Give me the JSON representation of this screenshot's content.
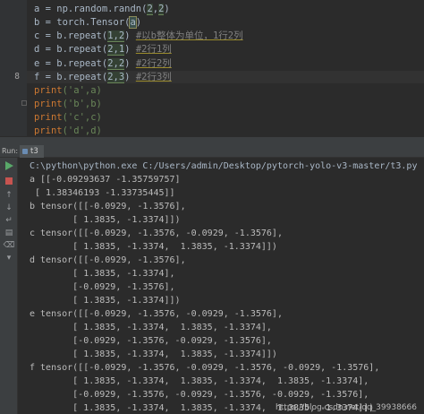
{
  "editor": {
    "line_numbers": [
      "",
      "",
      "",
      "",
      "",
      "8",
      "",
      "",
      "",
      ""
    ],
    "lines": [
      {
        "pre": "a = np.random.randn(",
        "mid": "2",
        "sep": ",",
        "mid2": "2",
        "post": ")"
      },
      {
        "pre": "b = torch.Tensor(",
        "sel": "a",
        "post": ")"
      },
      {
        "pre": "c = b.repeat(",
        "args": "1,2",
        "post": ") ",
        "comment": "#以b整体为单位，1行2列"
      },
      {
        "pre": "d = b.repeat(",
        "args": "2,1",
        "post": ") ",
        "comment": "#2行1列"
      },
      {
        "pre": "e = b.repeat(",
        "args": "2,2",
        "post": ") ",
        "comment": "#2行2列"
      },
      {
        "pre": "f = b.repeat(",
        "args": "2,3",
        "post": ") ",
        "comment": "#2行3列"
      },
      {
        "fn": "print",
        "open": "('",
        "arg": "a",
        "close": "',a)"
      },
      {
        "fn": "print",
        "open": "('",
        "arg": "b",
        "close": "',b)"
      },
      {
        "fn": "print",
        "open": "('",
        "arg": "c",
        "close": "',c)"
      },
      {
        "fn": "print",
        "open": "('",
        "arg": "d",
        "close": "',d)"
      }
    ]
  },
  "run": {
    "label": "Run:",
    "tab": "t3"
  },
  "console": {
    "command": "C:\\python\\python.exe C:/Users/admin/Desktop/pytorch-yolo-v3-master/t3.py",
    "output": [
      "a [[-0.09293637 -1.35759757]",
      " [ 1.38346193 -1.33735445]]",
      "b tensor([[-0.0929, -1.3576],",
      "        [ 1.3835, -1.3374]])",
      "c tensor([[-0.0929, -1.3576, -0.0929, -1.3576],",
      "        [ 1.3835, -1.3374,  1.3835, -1.3374]])",
      "d tensor([[-0.0929, -1.3576],",
      "        [ 1.3835, -1.3374],",
      "        [-0.0929, -1.3576],",
      "        [ 1.3835, -1.3374]])",
      "e tensor([[-0.0929, -1.3576, -0.0929, -1.3576],",
      "        [ 1.3835, -1.3374,  1.3835, -1.3374],",
      "        [-0.0929, -1.3576, -0.0929, -1.3576],",
      "        [ 1.3835, -1.3374,  1.3835, -1.3374]])",
      "f tensor([[-0.0929, -1.3576, -0.0929, -1.3576, -0.0929, -1.3576],",
      "        [ 1.3835, -1.3374,  1.3835, -1.3374,  1.3835, -1.3374],",
      "        [-0.0929, -1.3576, -0.0929, -1.3576, -0.0929, -1.3576],",
      "        [ 1.3835, -1.3374,  1.3835, -1.3374,  1.3835, -1.3374]])"
    ]
  },
  "toolbar_icons": [
    "rerun-icon",
    "stop-icon",
    "scroll-up-icon",
    "scroll-down-icon",
    "soft-wrap-icon",
    "print-icon",
    "clear-icon",
    "pin-icon"
  ],
  "watermark": "https://blog.csdn.net/qq_39938666",
  "colors": {
    "bg": "#2b2b2b",
    "gutter": "#313335",
    "keyword": "#cc7832",
    "comment": "#808080",
    "string": "#6a8759"
  }
}
